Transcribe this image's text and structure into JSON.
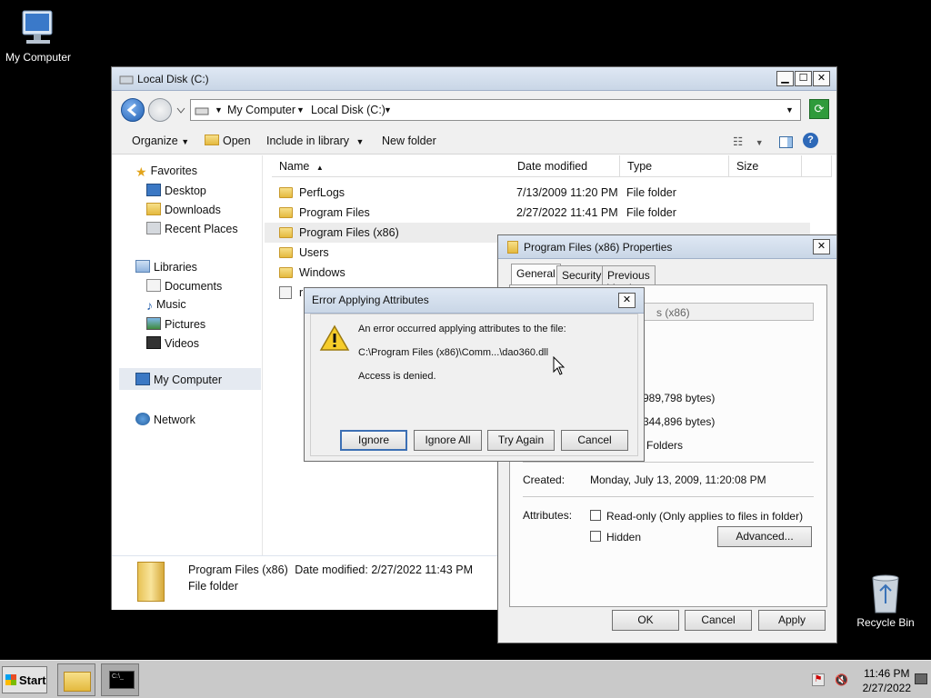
{
  "desktop": {
    "icons": [
      {
        "name": "my-computer",
        "label": "My Computer"
      },
      {
        "name": "recycle-bin",
        "label": "Recycle Bin"
      }
    ]
  },
  "explorer": {
    "title": "Local Disk (C:)",
    "breadcrumb": [
      "My Computer",
      "Local Disk (C:)"
    ],
    "toolbar": {
      "organize": "Organize",
      "open": "Open",
      "include": "Include in library",
      "new_folder": "New folder"
    },
    "nav": {
      "favorites": "Favorites",
      "desktop": "Desktop",
      "downloads": "Downloads",
      "recent": "Recent Places",
      "libraries": "Libraries",
      "documents": "Documents",
      "music": "Music",
      "pictures": "Pictures",
      "videos": "Videos",
      "computer": "My Computer",
      "network": "Network"
    },
    "columns": {
      "name": "Name",
      "date": "Date modified",
      "type": "Type",
      "size": "Size"
    },
    "rows": [
      {
        "name": "PerfLogs",
        "date": "7/13/2009 11:20 PM",
        "type": "File folder"
      },
      {
        "name": "Program Files",
        "date": "2/27/2022 11:41 PM",
        "type": "File folder"
      },
      {
        "name": "Program Files (x86)",
        "date": "",
        "type": ""
      },
      {
        "name": "Users",
        "date": "",
        "type": ""
      },
      {
        "name": "Windows",
        "date": "",
        "type": ""
      },
      {
        "name": "r",
        "date": "",
        "type": ""
      }
    ],
    "details": {
      "name": "Program Files (x86)",
      "modified_label": "Date modified:",
      "modified": "2/27/2022 11:43 PM",
      "type": "File folder"
    }
  },
  "properties": {
    "title": "Program Files (x86) Properties",
    "tabs": [
      "General",
      "Security",
      "Previous Versions"
    ],
    "name_partial": "s (x86)",
    "size_partial": "989,798 bytes)",
    "size_disk_partial": "344,896 bytes)",
    "contains_partial": "Folders",
    "created_label": "Created:",
    "created": "Monday, July 13, 2009, 11:20:08 PM",
    "attributes_label": "Attributes:",
    "readonly": "Read-only (Only applies to files in folder)",
    "hidden": "Hidden",
    "advanced": "Advanced...",
    "ok": "OK",
    "cancel": "Cancel",
    "apply": "Apply"
  },
  "error_dialog": {
    "title": "Error Applying Attributes",
    "message": "An error occurred applying attributes to the file:",
    "path": "C:\\Program Files (x86)\\Comm...\\dao360.dll",
    "detail": "Access is denied.",
    "buttons": {
      "ignore": "Ignore",
      "ignore_all": "Ignore All",
      "try_again": "Try Again",
      "cancel": "Cancel"
    }
  },
  "taskbar": {
    "start": "Start",
    "time": "11:46 PM",
    "date": "2/27/2022"
  }
}
